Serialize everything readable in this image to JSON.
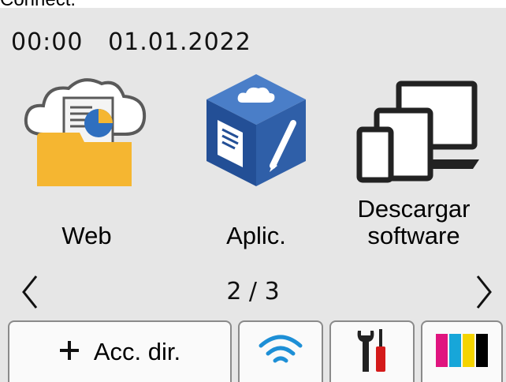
{
  "header_fragment": "Connect.",
  "status": {
    "time": "00:00",
    "date": "01.01.2022"
  },
  "apps": [
    {
      "label": "Web",
      "icon": "web-folder-icon"
    },
    {
      "label": "Aplic.",
      "icon": "apps-cube-icon"
    },
    {
      "label_line1": "Descargar",
      "label_line2": "software",
      "icon": "devices-icon"
    }
  ],
  "pagination": {
    "text": "2 / 3",
    "prev_icon": "chevron-left-icon",
    "next_icon": "chevron-right-icon"
  },
  "bottom_bar": {
    "shortcut_label": "Acc. dir.",
    "shortcut_icon": "plus-icon",
    "wifi_icon": "wifi-icon",
    "settings_icon": "wrench-screwdriver-icon",
    "ink_icon": "ink-cartridges-icon"
  },
  "colors": {
    "screen_bg": "#e6e6e6",
    "folder": "#f5b631",
    "cube": "#2f5fa8",
    "ink_magenta": "#e0157f",
    "ink_cyan": "#17a6d9",
    "ink_yellow": "#f4d400",
    "ink_black": "#000000"
  }
}
